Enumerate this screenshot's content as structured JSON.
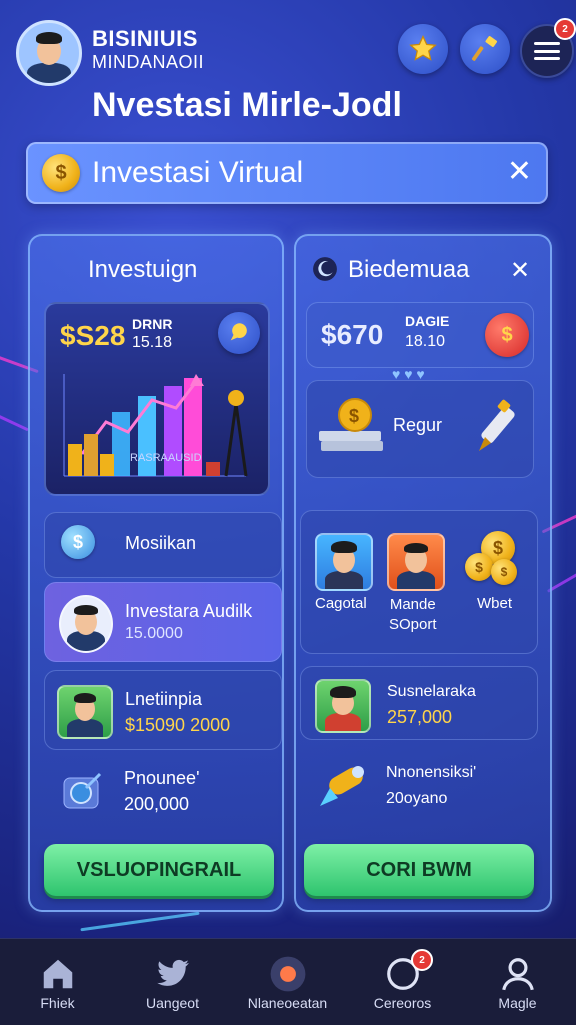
{
  "header": {
    "brand_line1": "BISINIUIS",
    "brand_line2": "MINDANAOII",
    "title": "Nvestasi Mirle-Jodl",
    "notification_count": "2"
  },
  "banner": {
    "title": "Investasi Virtual",
    "coin_symbol": "$",
    "close_label": "✕"
  },
  "left_panel": {
    "title": "Investuign",
    "chart_card": {
      "price": "$S28",
      "sub_label": "DRNR",
      "sub_value": "15.18",
      "chart_caption": "RASRAAUSID"
    },
    "items": [
      {
        "title": "Mosiikan"
      },
      {
        "title": "Investara Audilk",
        "value": "15.0000"
      },
      {
        "title": "Lnetiinpia",
        "value": "$15090 2000"
      },
      {
        "title": "Pnounee'",
        "value": "200,000"
      }
    ],
    "cta_label": "VSLUOPINGRAIL"
  },
  "right_panel": {
    "title": "Biedemuaa",
    "close_label": "✕",
    "price_card": {
      "price": "$670",
      "sub_label": "DAGIE",
      "sub_value": "18.10"
    },
    "item_label": "Regur",
    "people": [
      {
        "label": "Cagotal"
      },
      {
        "label": "Mande\nSOport"
      },
      {
        "label": "Wbet"
      }
    ],
    "list": [
      {
        "title": "Susnelaraka",
        "value": "257,000"
      },
      {
        "title": "Nnonensiksi'",
        "value": "20oyano"
      }
    ],
    "cta_label": "CORI BWM"
  },
  "bottom_nav": [
    {
      "label": "Fhiek",
      "icon": "home-icon"
    },
    {
      "label": "Uangeot",
      "icon": "bird-icon"
    },
    {
      "label": "Nlaneoeatan",
      "icon": "record-icon"
    },
    {
      "label": "Cereoros",
      "icon": "chat-bubble-icon",
      "badge": "2"
    },
    {
      "label": "Magle",
      "icon": "user-icon"
    }
  ],
  "colors": {
    "accent_green": "#2ec46e",
    "gold": "#ffd54a",
    "badge_red": "#e53935"
  }
}
